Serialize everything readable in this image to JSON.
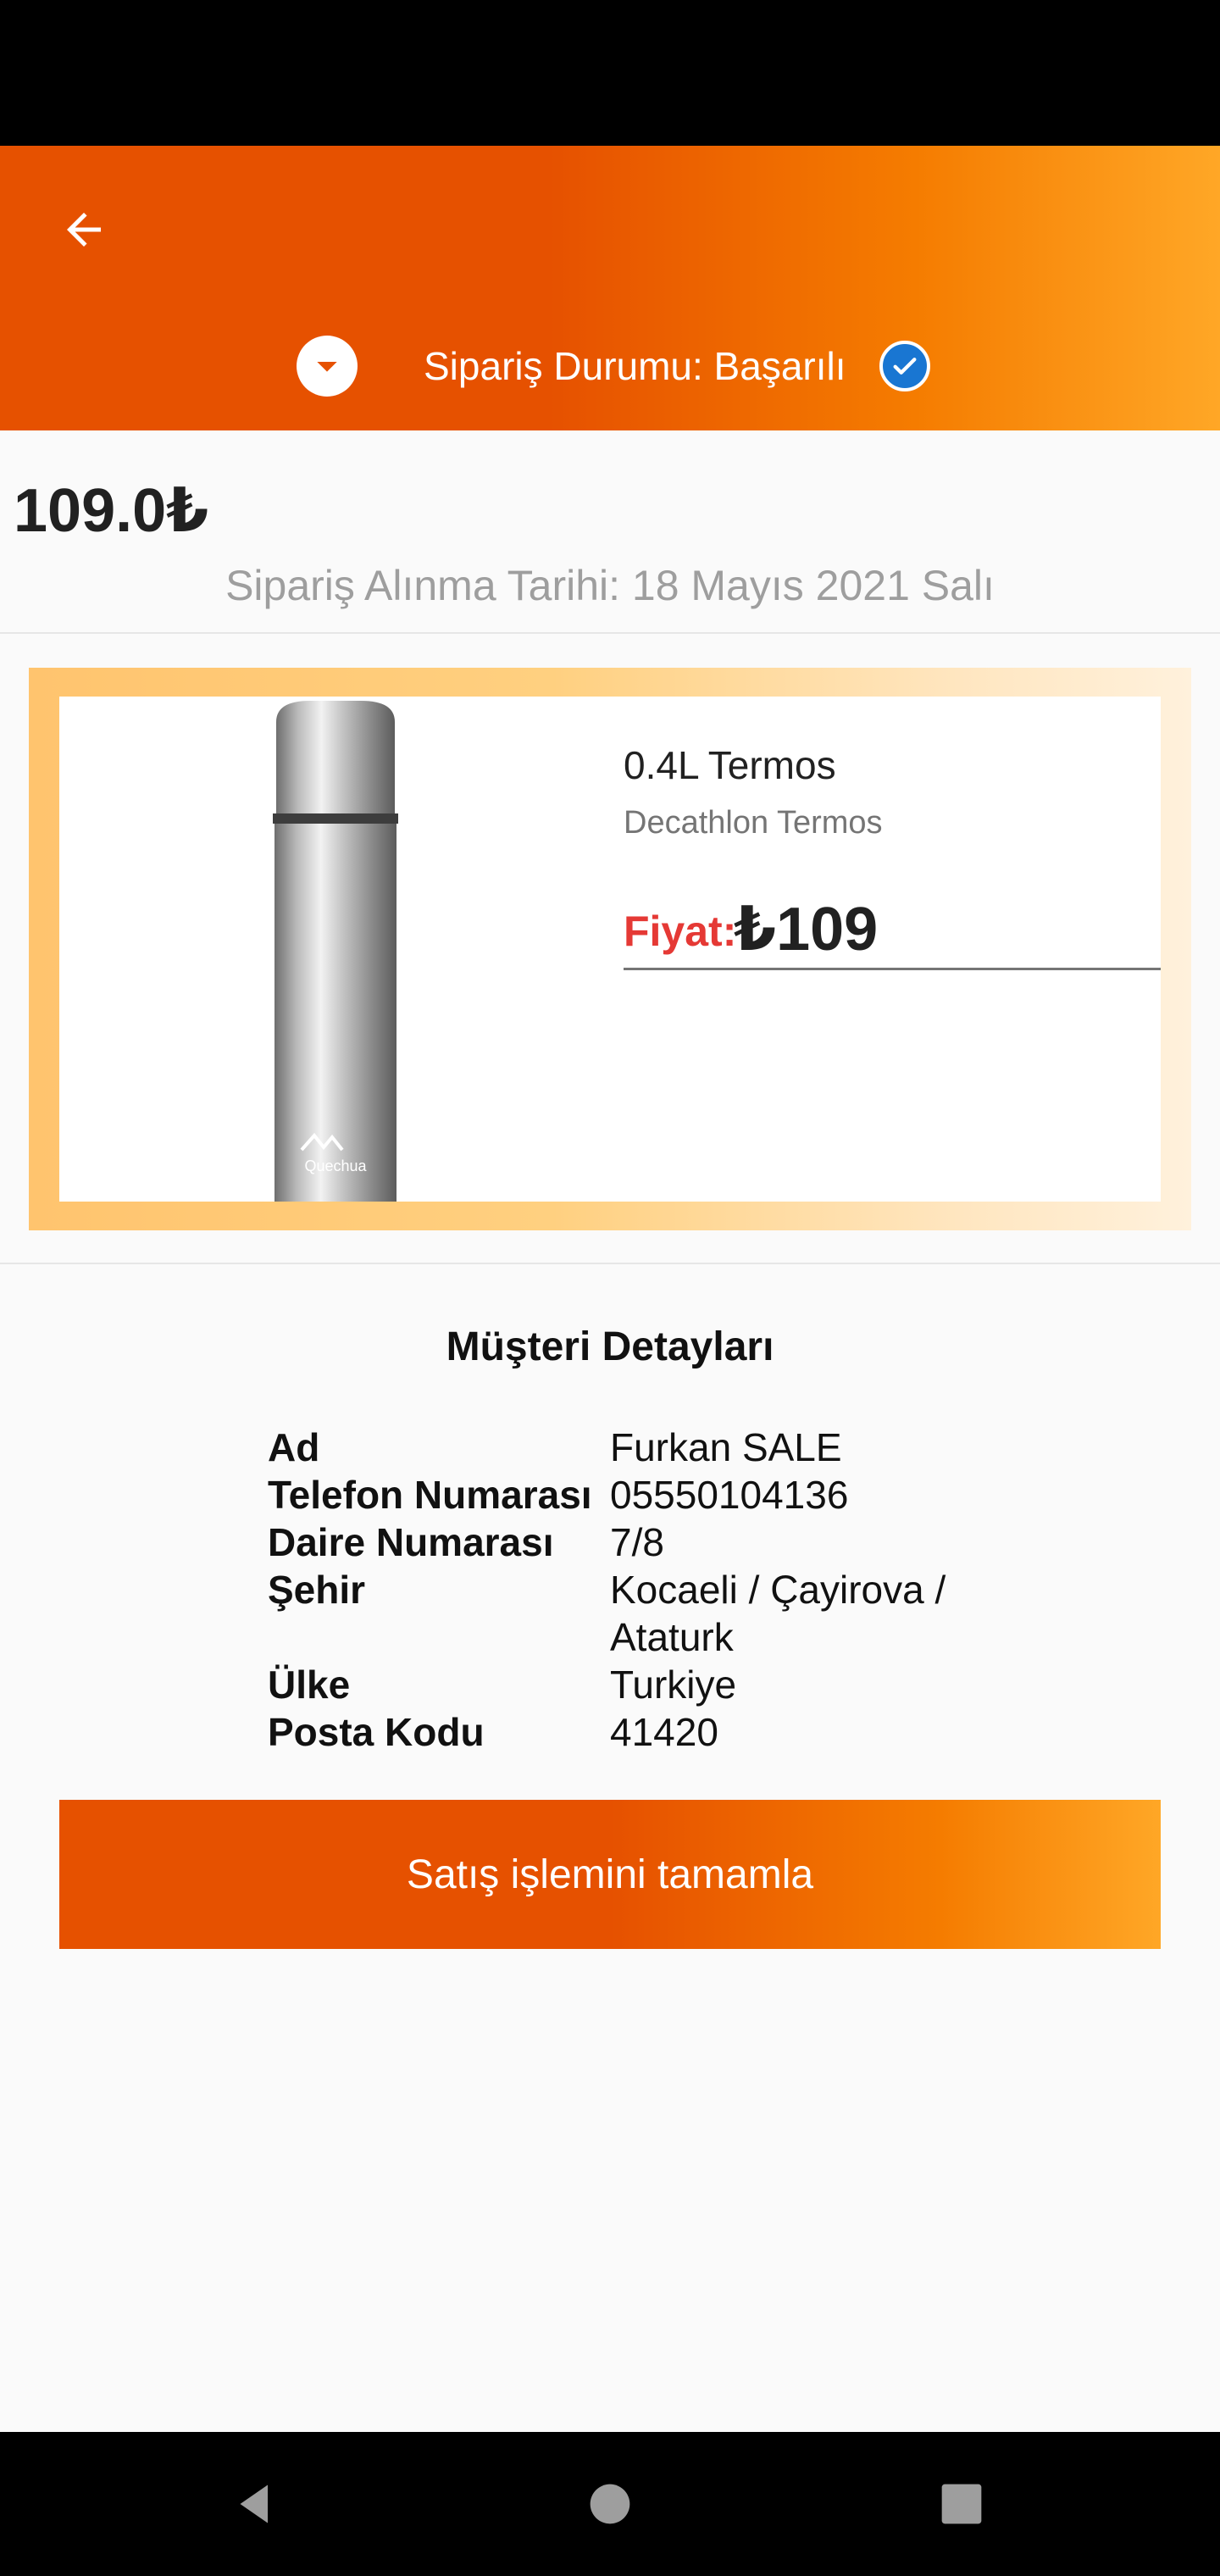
{
  "header": {
    "status_text": "Sipariş Durumu: Başarılı"
  },
  "order": {
    "total_price": "109.0₺",
    "date_text": "Sipariş Alınma Tarihi: 18 Mayıs 2021 Salı"
  },
  "product": {
    "name": "0.4L Termos",
    "brand": "Decathlon Termos",
    "price_label": "Fiyat:",
    "price_value": "₺109",
    "image_logo_text": "Quechua"
  },
  "customer": {
    "title": "Müşteri Detayları",
    "rows": [
      {
        "key": "Ad",
        "value": "Furkan SALE"
      },
      {
        "key": "Telefon Numarası",
        "value": "05550104136"
      },
      {
        "key": "Daire Numarası",
        "value": "7/8"
      },
      {
        "key": "Şehir",
        "value": "Kocaeli / Çayirova / Ataturk"
      },
      {
        "key": "Ülke",
        "value": "Turkiye"
      },
      {
        "key": "Posta Kodu",
        "value": "41420"
      }
    ]
  },
  "actions": {
    "complete_label": "Satış işlemini tamamla"
  },
  "colors": {
    "accent": "#e65100",
    "accent_light": "#ffa726",
    "price_red": "#e53935",
    "check_blue": "#1976d2"
  },
  "icons": {
    "back": "arrow-left-icon",
    "dropdown": "chevron-down-circle-icon",
    "status": "check-circle-icon",
    "nav_back": "triangle-back-icon",
    "nav_home": "circle-home-icon",
    "nav_recents": "square-recents-icon"
  }
}
